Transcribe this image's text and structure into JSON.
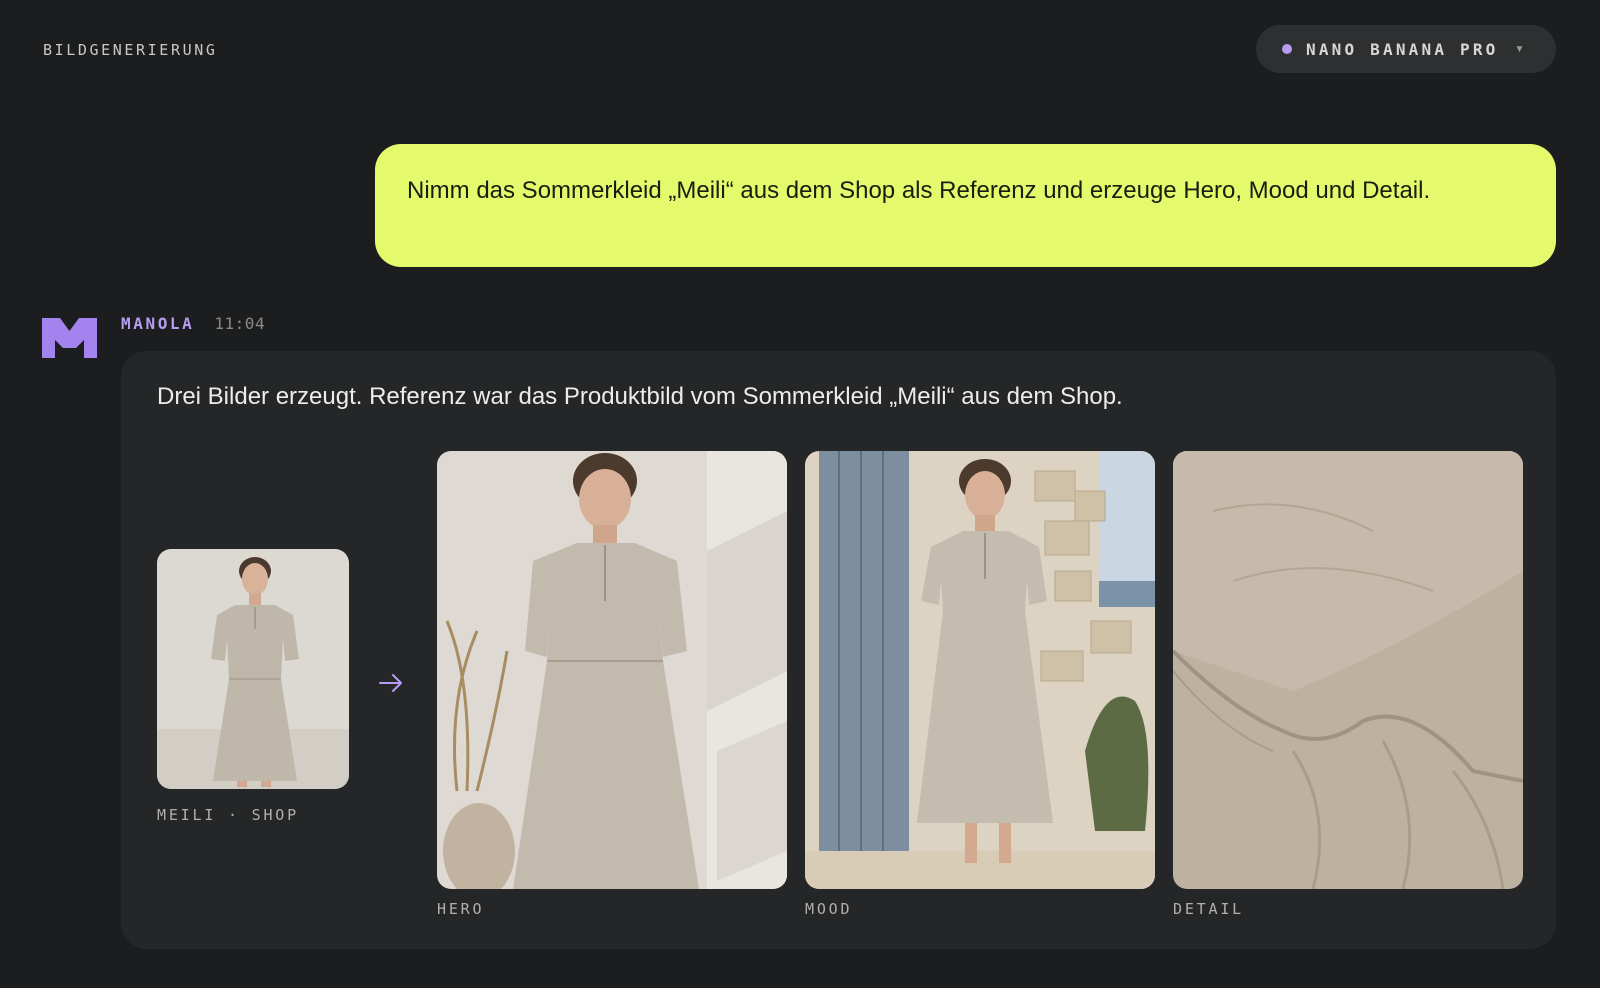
{
  "header": {
    "title": "BILDGENERIERUNG",
    "model_selector": {
      "label": "NANO BANANA PRO",
      "dot_color": "#b79cf2",
      "icon": "chevron-down-icon"
    }
  },
  "user_message": {
    "text": "Nimm das Sommerkleid „Meili“ aus dem Shop als Referenz und erzeuge Hero, Mood und Detail.",
    "bubble_color": "#e4fa6c"
  },
  "assistant_message": {
    "sender": "MANOLA",
    "time": "11:04",
    "avatar_icon": "manola-logo-icon",
    "text": "Drei Bilder erzeugt. Referenz war das Produktbild vom Sommerkleid „Meili“ aus dem Shop.",
    "reference": {
      "caption": "MEILI · SHOP"
    },
    "results": [
      {
        "caption": "HERO"
      },
      {
        "caption": "MOOD"
      },
      {
        "caption": "DETAIL"
      }
    ]
  },
  "colors": {
    "background": "#1c1d1e",
    "card": "#252627",
    "accent": "#b79cf2"
  }
}
